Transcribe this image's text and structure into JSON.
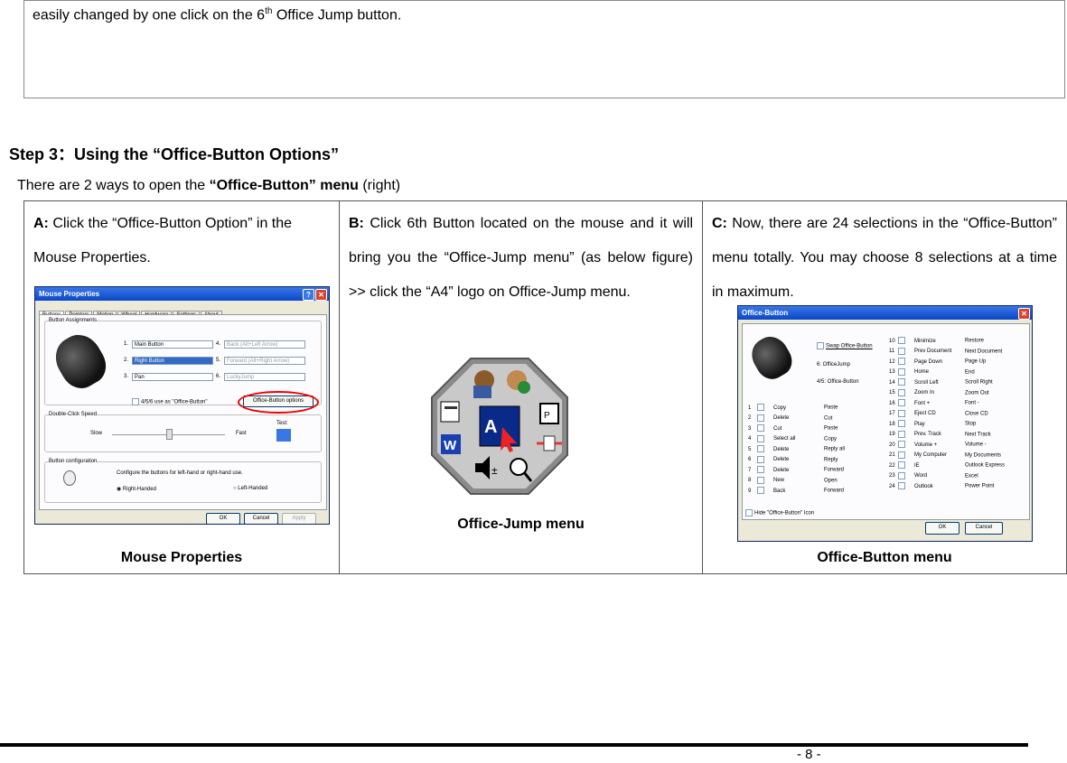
{
  "top_box": {
    "text_before": "easily changed by one click on the 6",
    "sup": "th",
    "text_after": " Office Jump button."
  },
  "step_title": "Step 3：Using the “Office-Button Options”",
  "intro": {
    "before": "There are 2 ways to open the ",
    "bold": "“Office-Button” menu",
    "after": " (right)"
  },
  "col_a": {
    "label": "A:",
    "text": " Click the “Office-Button Option” in the Mouse Properties.",
    "caption": "Mouse Properties"
  },
  "col_b": {
    "label": "B:",
    "text": " Click 6th Button located on the mouse and it will bring you the “Office-Jump menu” (as below figure) >> click the “A4” logo on Office-Jump menu.",
    "caption": "Office-Jump menu"
  },
  "col_c": {
    "label": "C:",
    "text": " Now, there are 24 selections in the “Office-Button” menu totally. You may choose 8 selections at a time in maximum.",
    "caption": "Office-Button menu"
  },
  "mouse_properties_window": {
    "title": "Mouse Properties",
    "tabs": [
      "Buttons",
      "Pointers",
      "Motion",
      "Wheel",
      "Hardware",
      "Settings",
      "About"
    ],
    "group_assign": "Button Assignments",
    "assign": [
      {
        "n": "1.",
        "v": "Main Button"
      },
      {
        "n": "2.",
        "v": "Right Button"
      },
      {
        "n": "3.",
        "v": "Pan"
      },
      {
        "n": "4.",
        "v": "Back (Alt+Left Arrow)"
      },
      {
        "n": "5.",
        "v": "Forward (Alt+Right Arrow)"
      },
      {
        "n": "6.",
        "v": "LuckyJump"
      }
    ],
    "office_check": "4/5/6 use as \"Office-Button\"",
    "office_btn": "Office-Button options",
    "group_speed": "Double-Click Speed",
    "slow": "Slow",
    "fast": "Fast",
    "test": "Test:",
    "group_config": "Button configuration",
    "config_text": "Configure the buttons for left-hand or right-hand use.",
    "right_handed": "Right-Handed",
    "left_handed": "Left-Handed",
    "ok": "OK",
    "cancel": "Cancel",
    "apply": "Apply"
  },
  "office_button_window": {
    "title": "Office-Button",
    "swap": "Swap Office-Button",
    "label6": "6: OfficeJump",
    "label45": "4/5: Office-Button",
    "hide": "Hide \"Office-Button\" Icon",
    "ok": "OK",
    "cancel": "Cancel",
    "left_rows": [
      {
        "n": "1",
        "a": "Copy",
        "b": "Paste"
      },
      {
        "n": "2",
        "a": "Delete",
        "b": "Cut"
      },
      {
        "n": "3",
        "a": "Cut",
        "b": "Paste"
      },
      {
        "n": "4",
        "a": "Select all",
        "b": "Copy"
      },
      {
        "n": "5",
        "a": "Delete",
        "b": "Reply all"
      },
      {
        "n": "6",
        "a": "Delete",
        "b": "Reply"
      },
      {
        "n": "7",
        "a": "Delete",
        "b": "Forward"
      },
      {
        "n": "8",
        "a": "New",
        "b": "Open"
      },
      {
        "n": "9",
        "a": "Back",
        "b": "Forward"
      }
    ],
    "right_rows": [
      {
        "n": "10",
        "a": "Minimize",
        "b": "Restore"
      },
      {
        "n": "11",
        "a": "Prev Document",
        "b": "Next Document"
      },
      {
        "n": "12",
        "a": "Page Down",
        "b": "Page Up"
      },
      {
        "n": "13",
        "a": "Home",
        "b": "End"
      },
      {
        "n": "14",
        "a": "Scroll Left",
        "b": "Scroll Right"
      },
      {
        "n": "15",
        "a": "Zoom In",
        "b": "Zoom Out"
      },
      {
        "n": "16",
        "a": "Font +",
        "b": "Font -"
      },
      {
        "n": "17",
        "a": "Eject CD",
        "b": "Close CD"
      },
      {
        "n": "18",
        "a": "Play",
        "b": "Stop"
      },
      {
        "n": "19",
        "a": "Prev. Track",
        "b": "Next Track"
      },
      {
        "n": "20",
        "a": "Volume +",
        "b": "Volume -"
      },
      {
        "n": "21",
        "a": "My Computer",
        "b": "My Documents"
      },
      {
        "n": "22",
        "a": "IE",
        "b": "Outlook Express"
      },
      {
        "n": "23",
        "a": "Word",
        "b": "Excel"
      },
      {
        "n": "24",
        "a": "Outlook",
        "b": "Power Point"
      }
    ]
  },
  "page_number": "- 8 -"
}
